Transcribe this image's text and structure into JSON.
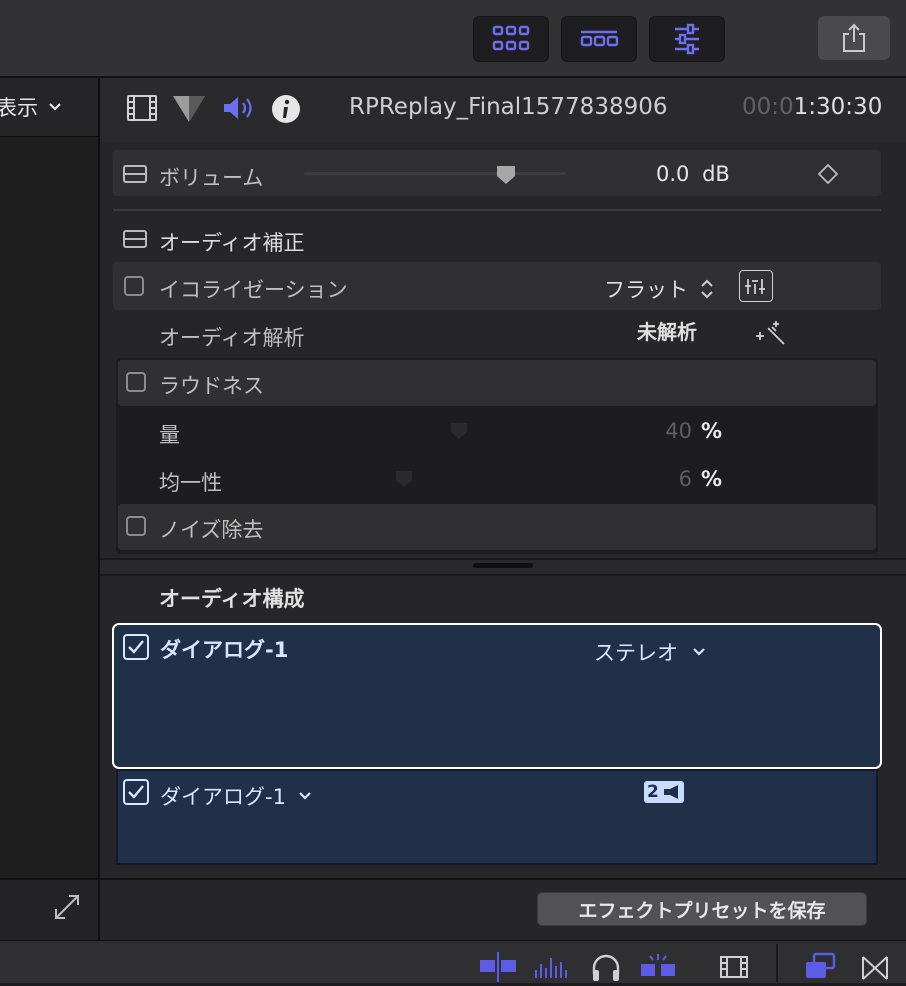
{
  "toolbar": {
    "buttons": [
      {
        "name": "browser-view-button",
        "icon": "grid-icon"
      },
      {
        "name": "timeline-view-button",
        "icon": "filmstrip-icon"
      },
      {
        "name": "inspector-button",
        "icon": "sliders-icon"
      }
    ],
    "share_icon": "share-icon",
    "accent": "#5e5ce6"
  },
  "left_panel": {
    "view_label": "表示"
  },
  "inspector": {
    "tabs": [
      "video-tab-icon",
      "color-tab-icon",
      "audio-tab-icon",
      "info-tab-icon"
    ],
    "clip_name": "RPReplay_Final1577838906",
    "timecode_dim": "00:0",
    "timecode_lit": "1:30:30",
    "volume": {
      "label": "ボリューム",
      "value": "0.0",
      "unit": "dB",
      "level": 0.68
    },
    "audio_enhance": {
      "title": "オーディオ補正",
      "equalization": {
        "label": "イコライゼーション",
        "value": "フラット"
      },
      "analysis": {
        "label": "オーディオ解析",
        "status": "未解析"
      },
      "loudness": {
        "label": "ラウドネス",
        "amount": {
          "label": "量",
          "value": "40",
          "unit": "%"
        },
        "uniformity": {
          "label": "均一性",
          "value": "6",
          "unit": "%"
        }
      },
      "noise": {
        "label": "ノイズ除去"
      }
    },
    "configuration": {
      "title": "オーディオ構成",
      "role": {
        "label": "ダイアログ-1",
        "channel": "ステレオ"
      },
      "sub_role": {
        "label": "ダイアログ-1",
        "badge": "2"
      }
    },
    "save_preset": "エフェクトプリセットを保存"
  },
  "colors": {
    "selection": "#203048",
    "background": "#262628"
  }
}
